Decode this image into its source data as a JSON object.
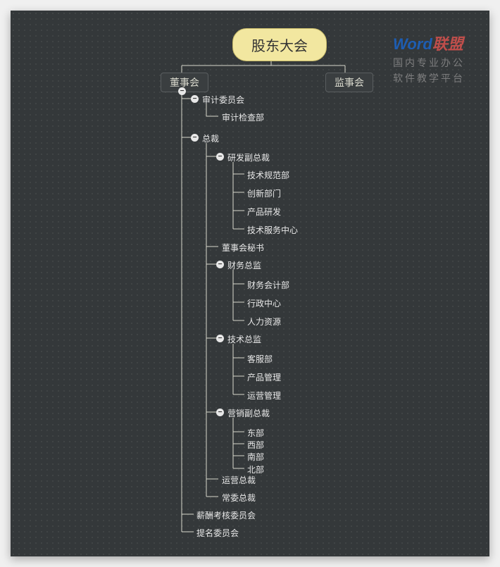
{
  "watermark": {
    "brand_prefix": "Word",
    "brand_suffix": "联盟",
    "subtitle1": "国内专业办公",
    "subtitle2": "软件教学平台"
  },
  "root": {
    "label": "股东大会"
  },
  "branch_left": {
    "label": "董事会"
  },
  "branch_right": {
    "label": "监事会"
  },
  "toggle": {
    "minus": "−"
  },
  "tree": {
    "a": {
      "label": "审计委员会",
      "c": [
        {
          "label": "审计检查部"
        }
      ]
    },
    "b": {
      "label": "总裁",
      "c1": {
        "label": "研发副总裁",
        "c": [
          {
            "label": "技术规范部"
          },
          {
            "label": "创新部门"
          },
          {
            "label": "产品研发"
          },
          {
            "label": "技术服务中心"
          }
        ]
      },
      "c2": {
        "label": "董事会秘书"
      },
      "c3": {
        "label": "财务总监",
        "c": [
          {
            "label": "财务会计部"
          },
          {
            "label": "行政中心"
          },
          {
            "label": "人力资源"
          }
        ]
      },
      "c4": {
        "label": "技术总监",
        "c": [
          {
            "label": "客服部"
          },
          {
            "label": "产品管理"
          },
          {
            "label": "运营管理"
          }
        ]
      },
      "c5": {
        "label": "营销副总裁",
        "c": [
          {
            "label": "东部"
          },
          {
            "label": "西部"
          },
          {
            "label": "南部"
          },
          {
            "label": "北部"
          }
        ]
      },
      "c6": {
        "label": "运营总裁"
      },
      "c7": {
        "label": "常委总裁"
      }
    },
    "d": {
      "label": "薪酬考核委员会"
    },
    "e": {
      "label": "提名委员会"
    }
  }
}
